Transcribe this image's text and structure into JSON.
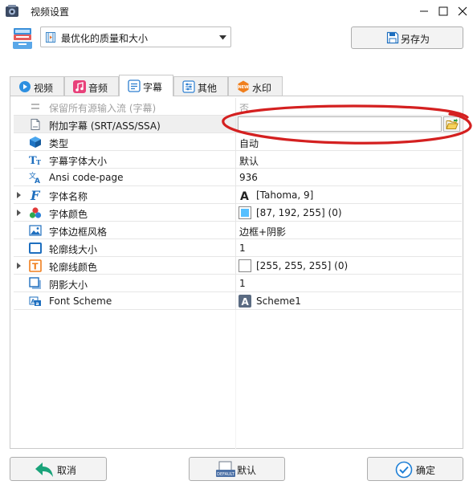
{
  "window": {
    "title": "视频设置"
  },
  "profile": {
    "value": "最优化的质量和大小",
    "save_as_label": "另存为"
  },
  "tabs": [
    {
      "label": "视频",
      "icon": "video-icon",
      "active": false
    },
    {
      "label": "音频",
      "icon": "audio-icon",
      "active": false
    },
    {
      "label": "字幕",
      "icon": "subtitle-icon",
      "active": true
    },
    {
      "label": "其他",
      "icon": "other-icon",
      "active": false
    },
    {
      "label": "水印",
      "icon": "watermark-icon",
      "active": false
    }
  ],
  "properties": [
    {
      "name": "保留所有源输入流 (字幕)",
      "value": "否",
      "icon": "list-icon",
      "disabled": true
    },
    {
      "name": "附加字幕 (SRT/ASS/SSA)",
      "value": "",
      "icon": "file-icon",
      "selected": true
    },
    {
      "name": "类型",
      "value": "自动",
      "icon": "cube-icon"
    },
    {
      "name": "字幕字体大小",
      "value": "默认",
      "icon": "font-size-icon"
    },
    {
      "name": "Ansi code-page",
      "value": "936",
      "icon": "translate-icon"
    },
    {
      "name": "字体名称",
      "value": "[Tahoma, 9]",
      "icon": "font-icon",
      "expandable": true,
      "value_icon": "letter-a-icon"
    },
    {
      "name": "字体颜色",
      "value": "[87, 192, 255] (0)",
      "icon": "palette-icon",
      "expandable": true,
      "value_icon": "color-swatch-icon",
      "swatch": "#57c0ff"
    },
    {
      "name": "字体边框风格",
      "value": "边框+阴影",
      "icon": "image-icon"
    },
    {
      "name": "轮廓线大小",
      "value": "1",
      "icon": "outline-size-icon"
    },
    {
      "name": "轮廓线颜色",
      "value": "[255, 255, 255] (0)",
      "icon": "outline-color-icon",
      "expandable": true,
      "value_icon": "color-swatch-icon",
      "swatch": "#ffffff"
    },
    {
      "name": "阴影大小",
      "value": "1",
      "icon": "shadow-icon"
    },
    {
      "name": "Font Scheme",
      "value": "Scheme1",
      "icon": "font-scheme-icon",
      "value_icon": "scheme-icon"
    }
  ],
  "buttons": {
    "cancel": "取消",
    "default": "默认",
    "ok": "确定"
  },
  "colors": {
    "accent": "#1e7fd6",
    "annotation": "#d42020",
    "cancel_arrow": "#1aa37a"
  }
}
